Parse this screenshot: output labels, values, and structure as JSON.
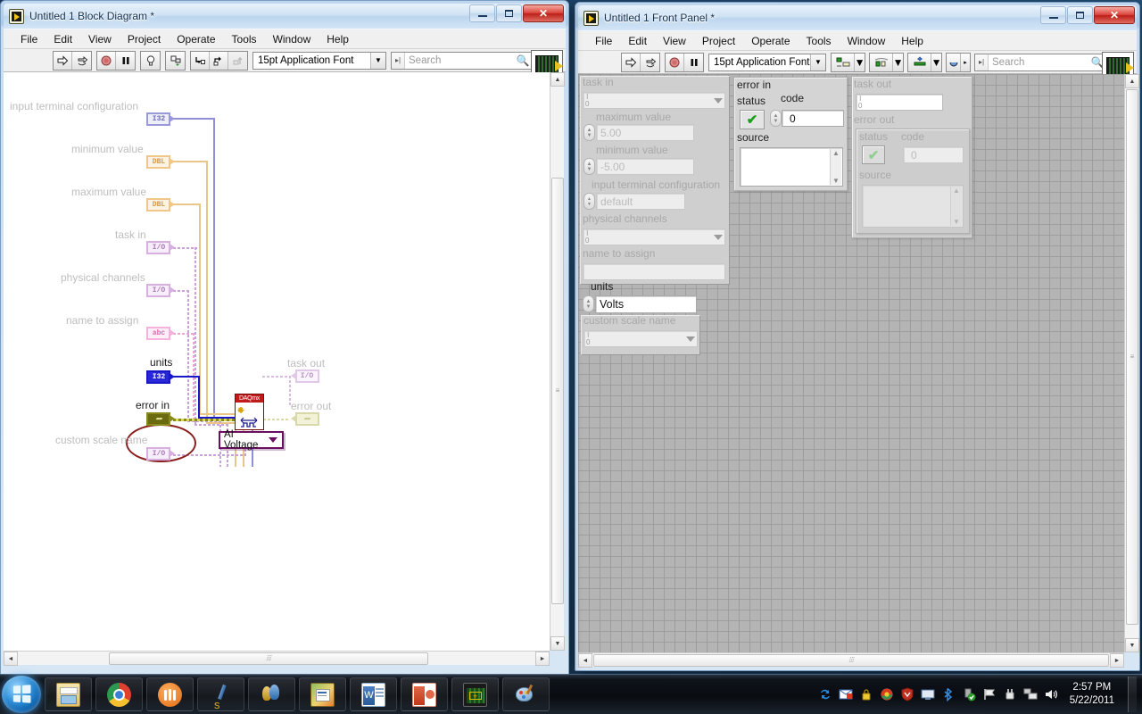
{
  "desktop": {
    "taskbar": {
      "start_label": "Start",
      "apps": [
        {
          "name": "windows-explorer",
          "label": "Windows Explorer"
        },
        {
          "name": "google-chrome",
          "label": "Google Chrome"
        },
        {
          "name": "orange-app",
          "label": "Application"
        },
        {
          "name": "pen-editor",
          "label": "Editor"
        },
        {
          "name": "windows-messenger",
          "label": "Windows Live Messenger"
        },
        {
          "name": "publisher",
          "label": "Microsoft Publisher"
        },
        {
          "name": "word",
          "label": "Microsoft Word"
        },
        {
          "name": "powerpoint",
          "label": "Microsoft PowerPoint"
        },
        {
          "name": "labview",
          "label": "NI LabVIEW"
        },
        {
          "name": "paint",
          "label": "Paint"
        }
      ],
      "tray": [
        {
          "name": "sync-icon"
        },
        {
          "name": "mail-icon"
        },
        {
          "name": "lock-icon"
        },
        {
          "name": "browser-icon"
        },
        {
          "name": "shield-icon"
        },
        {
          "name": "antivirus-icon"
        },
        {
          "name": "display-icon"
        },
        {
          "name": "bluetooth-icon"
        },
        {
          "name": "usb-safe-remove-icon"
        },
        {
          "name": "flag-action-center-icon"
        },
        {
          "name": "power-plug-icon"
        },
        {
          "name": "network-icon"
        },
        {
          "name": "volume-icon"
        }
      ],
      "clock": {
        "time": "2:57 PM",
        "date": "5/22/2011"
      }
    }
  },
  "block_diagram_window": {
    "title": "Untitled 1 Block Diagram *",
    "window_buttons": {
      "minimize": "–",
      "maximize": "□",
      "close": "✕"
    },
    "menus": [
      "File",
      "Edit",
      "View",
      "Project",
      "Operate",
      "Tools",
      "Window",
      "Help"
    ],
    "toolbar": {
      "buttons": [
        {
          "name": "run-button",
          "glyph": "⇨",
          "label": "Run"
        },
        {
          "name": "run-continuously-button",
          "glyph": "↻",
          "label": "Run Continuously"
        },
        {
          "name": "abort-execution-button",
          "glyph": "●",
          "label": "Abort Execution"
        },
        {
          "name": "pause-button",
          "glyph": "‖",
          "label": "Pause"
        },
        {
          "name": "highlight-execution-button",
          "glyph": "Ὂ1",
          "label": "Highlight Execution"
        },
        {
          "name": "retain-wire-values-button",
          "glyph": "⌘",
          "label": "Retain Wire Values"
        },
        {
          "name": "step-into-button",
          "glyph": "⬇",
          "label": "Step Into"
        },
        {
          "name": "step-over-button",
          "glyph": "↪",
          "label": "Step Over"
        },
        {
          "name": "step-out-button",
          "glyph": "⬆",
          "label": "Step Out"
        }
      ],
      "font_selector": "15pt Application Font",
      "search_placeholder": "Search",
      "help_label": "?",
      "connector_pane_number": "1"
    },
    "diagram": {
      "terminals": [
        {
          "label": "input terminal configuration",
          "type": "I32",
          "label_state": "dim",
          "term_color": "#8f8fd8"
        },
        {
          "label": "minimum value",
          "type": "DBL",
          "label_state": "dim",
          "term_color": "#e8a63c"
        },
        {
          "label": "maximum value",
          "type": "DBL",
          "label_state": "dim",
          "term_color": "#e8a63c"
        },
        {
          "label": "task in",
          "type": "I/O",
          "label_state": "dim",
          "term_color": "#b57fc0"
        },
        {
          "label": "physical channels",
          "type": "I/O",
          "label_state": "dim",
          "term_color": "#b57fc0"
        },
        {
          "label": "name to assign",
          "type": "abc",
          "label_state": "dim",
          "term_color": "#e87fc0"
        },
        {
          "label": "units",
          "type": "I32",
          "label_state": "selected",
          "term_color": "#1818c8"
        },
        {
          "label": "error in",
          "type": "cluster",
          "label_state": "dark",
          "term_color": "#8a8a1a"
        },
        {
          "label": "custom scale name",
          "type": "I/O",
          "label_state": "dim",
          "term_color": "#b57fc0"
        },
        {
          "label": "task out",
          "type": "I/O",
          "label_state": "dim",
          "term_color": "#b57fc0"
        },
        {
          "label": "error out",
          "type": "cluster",
          "label_state": "dim",
          "term_color": "#c8c88a"
        }
      ],
      "node": {
        "name": "DAQmx Create Virtual Channel",
        "header": "DAQmx"
      },
      "polymorphic_selector": {
        "value": "AI Voltage"
      },
      "annotation": {
        "name": "units-highlight-ellipse",
        "color": "#8a1f1f"
      }
    },
    "scroll": {
      "up": "▲",
      "down": "▼",
      "left": "◄",
      "right": "►",
      "grip": "≡"
    }
  },
  "front_panel_window": {
    "title": "Untitled 1 Front Panel *",
    "window_buttons": {
      "minimize": "–",
      "maximize": "□",
      "close": "✕"
    },
    "menus": [
      "File",
      "Edit",
      "View",
      "Project",
      "Operate",
      "Tools",
      "Window",
      "Help"
    ],
    "toolbar": {
      "buttons": [
        {
          "name": "run-button",
          "glyph": "⇨",
          "label": "Run"
        },
        {
          "name": "run-continuously-button",
          "glyph": "↻",
          "label": "Run Continuously"
        },
        {
          "name": "abort-execution-button",
          "glyph": "●",
          "label": "Abort Execution"
        },
        {
          "name": "pause-button",
          "glyph": "‖",
          "label": "Pause"
        }
      ],
      "font_selector": "15pt Application Font",
      "align_label": "Align Objects",
      "distribute_label": "Distribute Objects",
      "resize_label": "Resize Objects",
      "reorder_label": "Reorder",
      "search_placeholder": "Search",
      "help_label": "?",
      "connector_pane_number": "1"
    },
    "controls": {
      "task_in": {
        "caption": "task in",
        "value": "",
        "state": "dim"
      },
      "maximum_value": {
        "caption": "maximum value",
        "value": "5.00",
        "state": "dim"
      },
      "minimum_value": {
        "caption": "minimum value",
        "value": "-5.00",
        "state": "dim"
      },
      "input_terminal_configuration": {
        "caption": "input terminal configuration",
        "value": "default",
        "state": "dim"
      },
      "physical_channels": {
        "caption": "physical channels",
        "value": "",
        "state": "dim"
      },
      "name_to_assign": {
        "caption": "name to assign",
        "value": "",
        "state": "dim"
      },
      "units": {
        "caption": "units",
        "value": "Volts",
        "state": "active"
      },
      "custom_scale_name": {
        "caption": "custom scale name",
        "value": "",
        "state": "dim"
      },
      "error_in": {
        "caption": "error in",
        "status_caption": "status",
        "status_value": "✔",
        "code_caption": "code",
        "code_value": "0",
        "source_caption": "source",
        "source_value": "",
        "state": "active"
      },
      "task_out": {
        "caption": "task out",
        "value": "",
        "state": "dim"
      },
      "error_out": {
        "caption": "error out",
        "status_caption": "status",
        "status_value": "✔",
        "code_caption": "code",
        "code_value": "0",
        "source_caption": "source",
        "source_value": "",
        "state": "dim"
      }
    },
    "scroll": {
      "up": "▲",
      "down": "▼",
      "left": "◄",
      "right": "►",
      "grip": "≡"
    }
  }
}
